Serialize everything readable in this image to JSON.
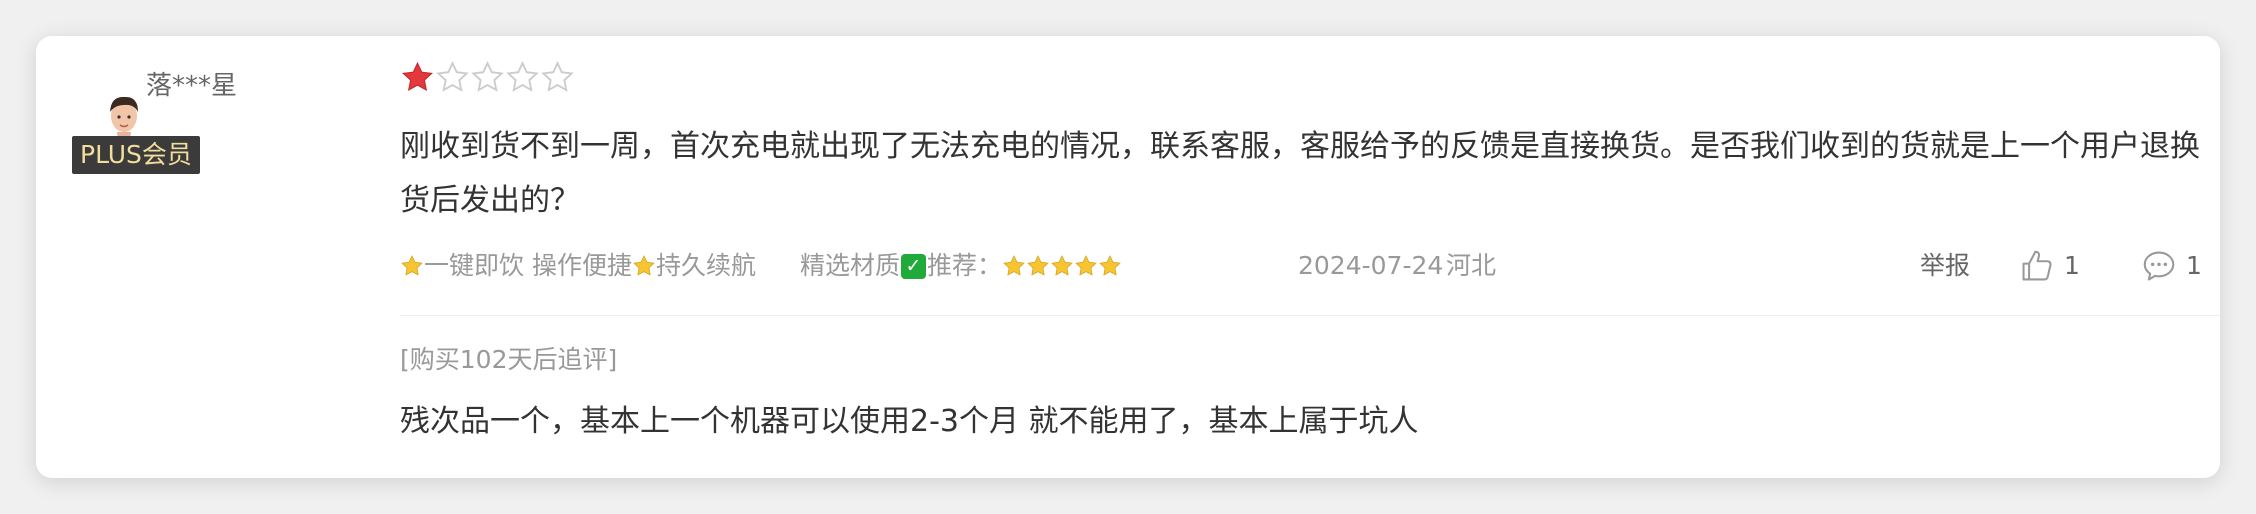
{
  "user": {
    "name": "落***星",
    "badge": "PLUS会员"
  },
  "rating": {
    "value": 1,
    "max": 5
  },
  "review": {
    "content": "刚收到货不到一周，首次充电就出现了无法充电的情况，联系客服，客服给予的反馈是直接换货。是否我们收到的货就是上一个用户退换货后发出的？",
    "tags": {
      "part1": "一键即饮 操作便捷",
      "part2": "持久续航",
      "part3": "精选材质",
      "part4": "推荐："
    },
    "date": "2024-07-24",
    "region": "河北",
    "report": "举报",
    "likes": "1",
    "comments": "1"
  },
  "followup": {
    "label": "[购买102天后追评]",
    "content": "残次品一个，基本上一个机器可以使用2-3个月 就不能用了，基本上属于坑人"
  },
  "colors": {
    "star_filled": "#e4393c",
    "star_empty_stroke": "#cccccc",
    "emoji_star": "#f7c531",
    "badge_bg": "#3b3b3b",
    "badge_text": "#f2dd9d",
    "check": "#1faa3a"
  },
  "icons": [
    "avatar",
    "star-icon",
    "thumbs-up-icon",
    "comment-icon",
    "check-icon"
  ]
}
